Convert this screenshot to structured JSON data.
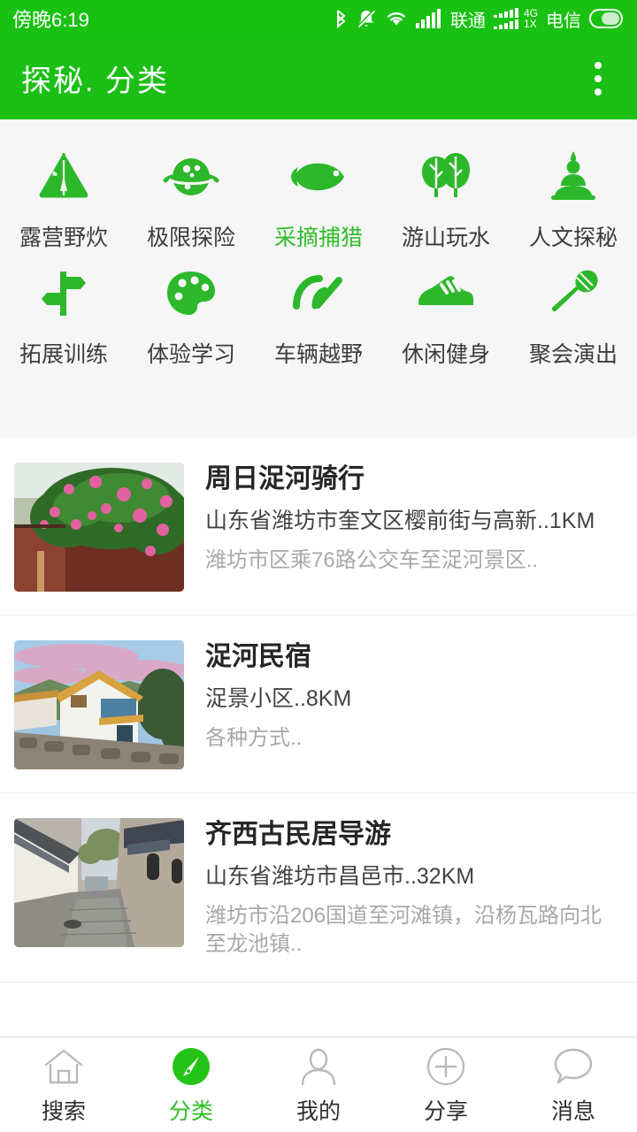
{
  "status_bar": {
    "time": "傍晚6:19",
    "icons": [
      "bluetooth-icon",
      "bell-muted-icon",
      "wifi-icon",
      "signal-bars-icon",
      "signal-bars-2-icon",
      "battery-icon"
    ],
    "carrier_1": "联通",
    "carrier_2": "电信",
    "network_type": "4G",
    "network_sub": "1X"
  },
  "app_bar": {
    "title": "探秘. 分类",
    "menu_icon": "overflow-menu-icon",
    "bg_color": "#1bbf16"
  },
  "categories": {
    "accent_color": "#2fbe2a",
    "items": [
      {
        "label": "露营野炊",
        "icon": "tent-icon",
        "active": false
      },
      {
        "label": "极限探险",
        "icon": "planet-icon",
        "active": false
      },
      {
        "label": "采摘捕猎",
        "icon": "fish-icon",
        "active": true
      },
      {
        "label": "游山玩水",
        "icon": "trees-icon",
        "active": false
      },
      {
        "label": "人文探秘",
        "icon": "buddha-icon",
        "active": false
      },
      {
        "label": "拓展训练",
        "icon": "signpost-icon",
        "active": false
      },
      {
        "label": "体验学习",
        "icon": "palette-icon",
        "active": false
      },
      {
        "label": "车辆越野",
        "icon": "speedometer-icon",
        "active": false
      },
      {
        "label": "休闲健身",
        "icon": "sneaker-icon",
        "active": false
      },
      {
        "label": "聚会演出",
        "icon": "microphone-icon",
        "active": false
      }
    ]
  },
  "listings": [
    {
      "title": "周日浞河骑行",
      "subtitle": "山东省潍坊市奎文区樱前街与高新..1KM",
      "description": "潍坊市区乘76路公交车至浞河景区..",
      "thumb": "roses-boardwalk-photo"
    },
    {
      "title": "浞河民宿",
      "subtitle": "浞景小区..8KM",
      "description": "各种方式..",
      "thumb": "white-villa-sunset-photo"
    },
    {
      "title": "齐西古民居导游",
      "subtitle": "山东省潍坊市昌邑市..32KM",
      "description": "潍坊市沿206国道至河滩镇，沿杨瓦路向北至龙池镇..",
      "thumb": "ancient-stone-alley-photo"
    }
  ],
  "bottom_nav": {
    "active_color": "#2fbe2a",
    "items": [
      {
        "label": "搜索",
        "icon": "home-icon",
        "active": false
      },
      {
        "label": "分类",
        "icon": "compass-icon",
        "active": true
      },
      {
        "label": "我的",
        "icon": "person-icon",
        "active": false
      },
      {
        "label": "分享",
        "icon": "plus-circle-icon",
        "active": false
      },
      {
        "label": "消息",
        "icon": "chat-bubble-icon",
        "active": false
      }
    ]
  }
}
